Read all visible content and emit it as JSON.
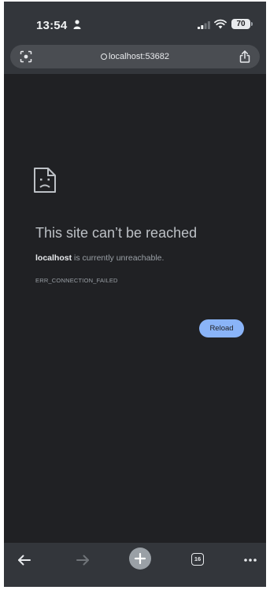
{
  "status_bar": {
    "time": "13:54",
    "battery": "70",
    "icons": [
      "person-icon",
      "signal-icon",
      "wifi-icon",
      "battery-icon"
    ]
  },
  "address_bar": {
    "url": "localhost:53682",
    "icons": [
      "lens-icon",
      "info-icon",
      "share-icon"
    ]
  },
  "error_page": {
    "icon": "sad-page-icon",
    "title": "This site can’t be reached",
    "host": "localhost",
    "description_suffix": " is currently unreachable.",
    "error_code": "ERR_CONNECTION_FAILED",
    "reload_label": "Reload"
  },
  "bottom_toolbar": {
    "tab_count": "16",
    "icons": [
      "back-arrow-icon",
      "forward-arrow-icon",
      "plus-icon",
      "tab-switcher-icon",
      "more-menu-icon"
    ]
  },
  "colors": {
    "page_background": "#202124",
    "chrome_background": "#33363b",
    "accent": "#8ab4f8"
  }
}
